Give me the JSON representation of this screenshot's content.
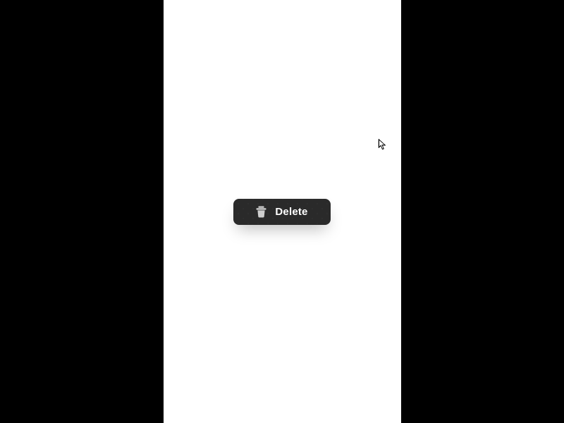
{
  "button": {
    "label": "Delete",
    "icon": "trash-icon"
  },
  "colors": {
    "background": "#000000",
    "panel": "#ffffff",
    "button_bg": "#2a2a2a",
    "button_text": "#ffffff",
    "icon": "#cfcfcf"
  }
}
